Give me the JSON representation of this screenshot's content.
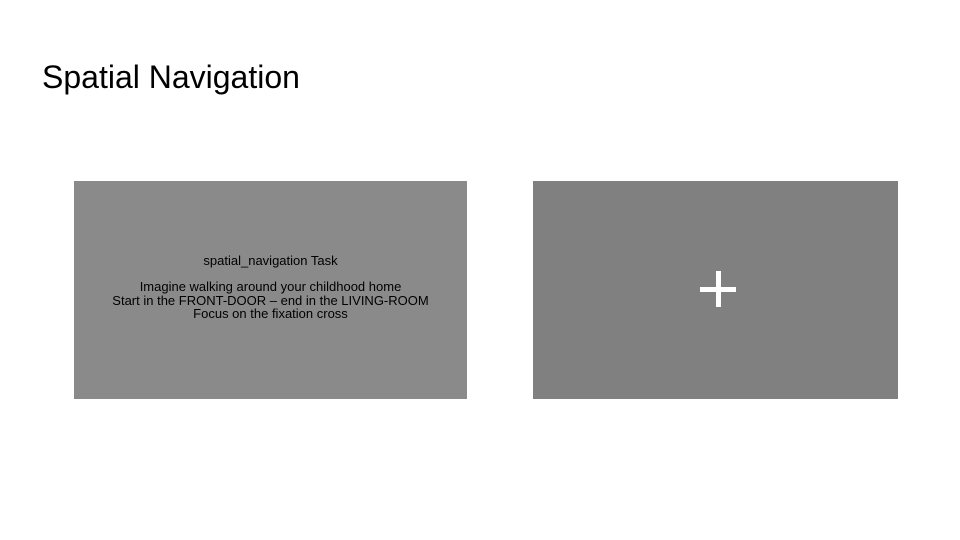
{
  "slide": {
    "title": "Spatial Navigation"
  },
  "instruction_panel": {
    "task_title": "spatial_navigation Task",
    "lines": [
      "Imagine walking around your childhood home",
      "Start in the FRONT-DOOR – end in the LIVING-ROOM",
      "Focus on the fixation cross"
    ],
    "background_color": "#8a8a8a"
  },
  "fixation_panel": {
    "icon": "fixation-cross-icon",
    "background_color": "#808080",
    "cross_color": "#ffffff"
  }
}
